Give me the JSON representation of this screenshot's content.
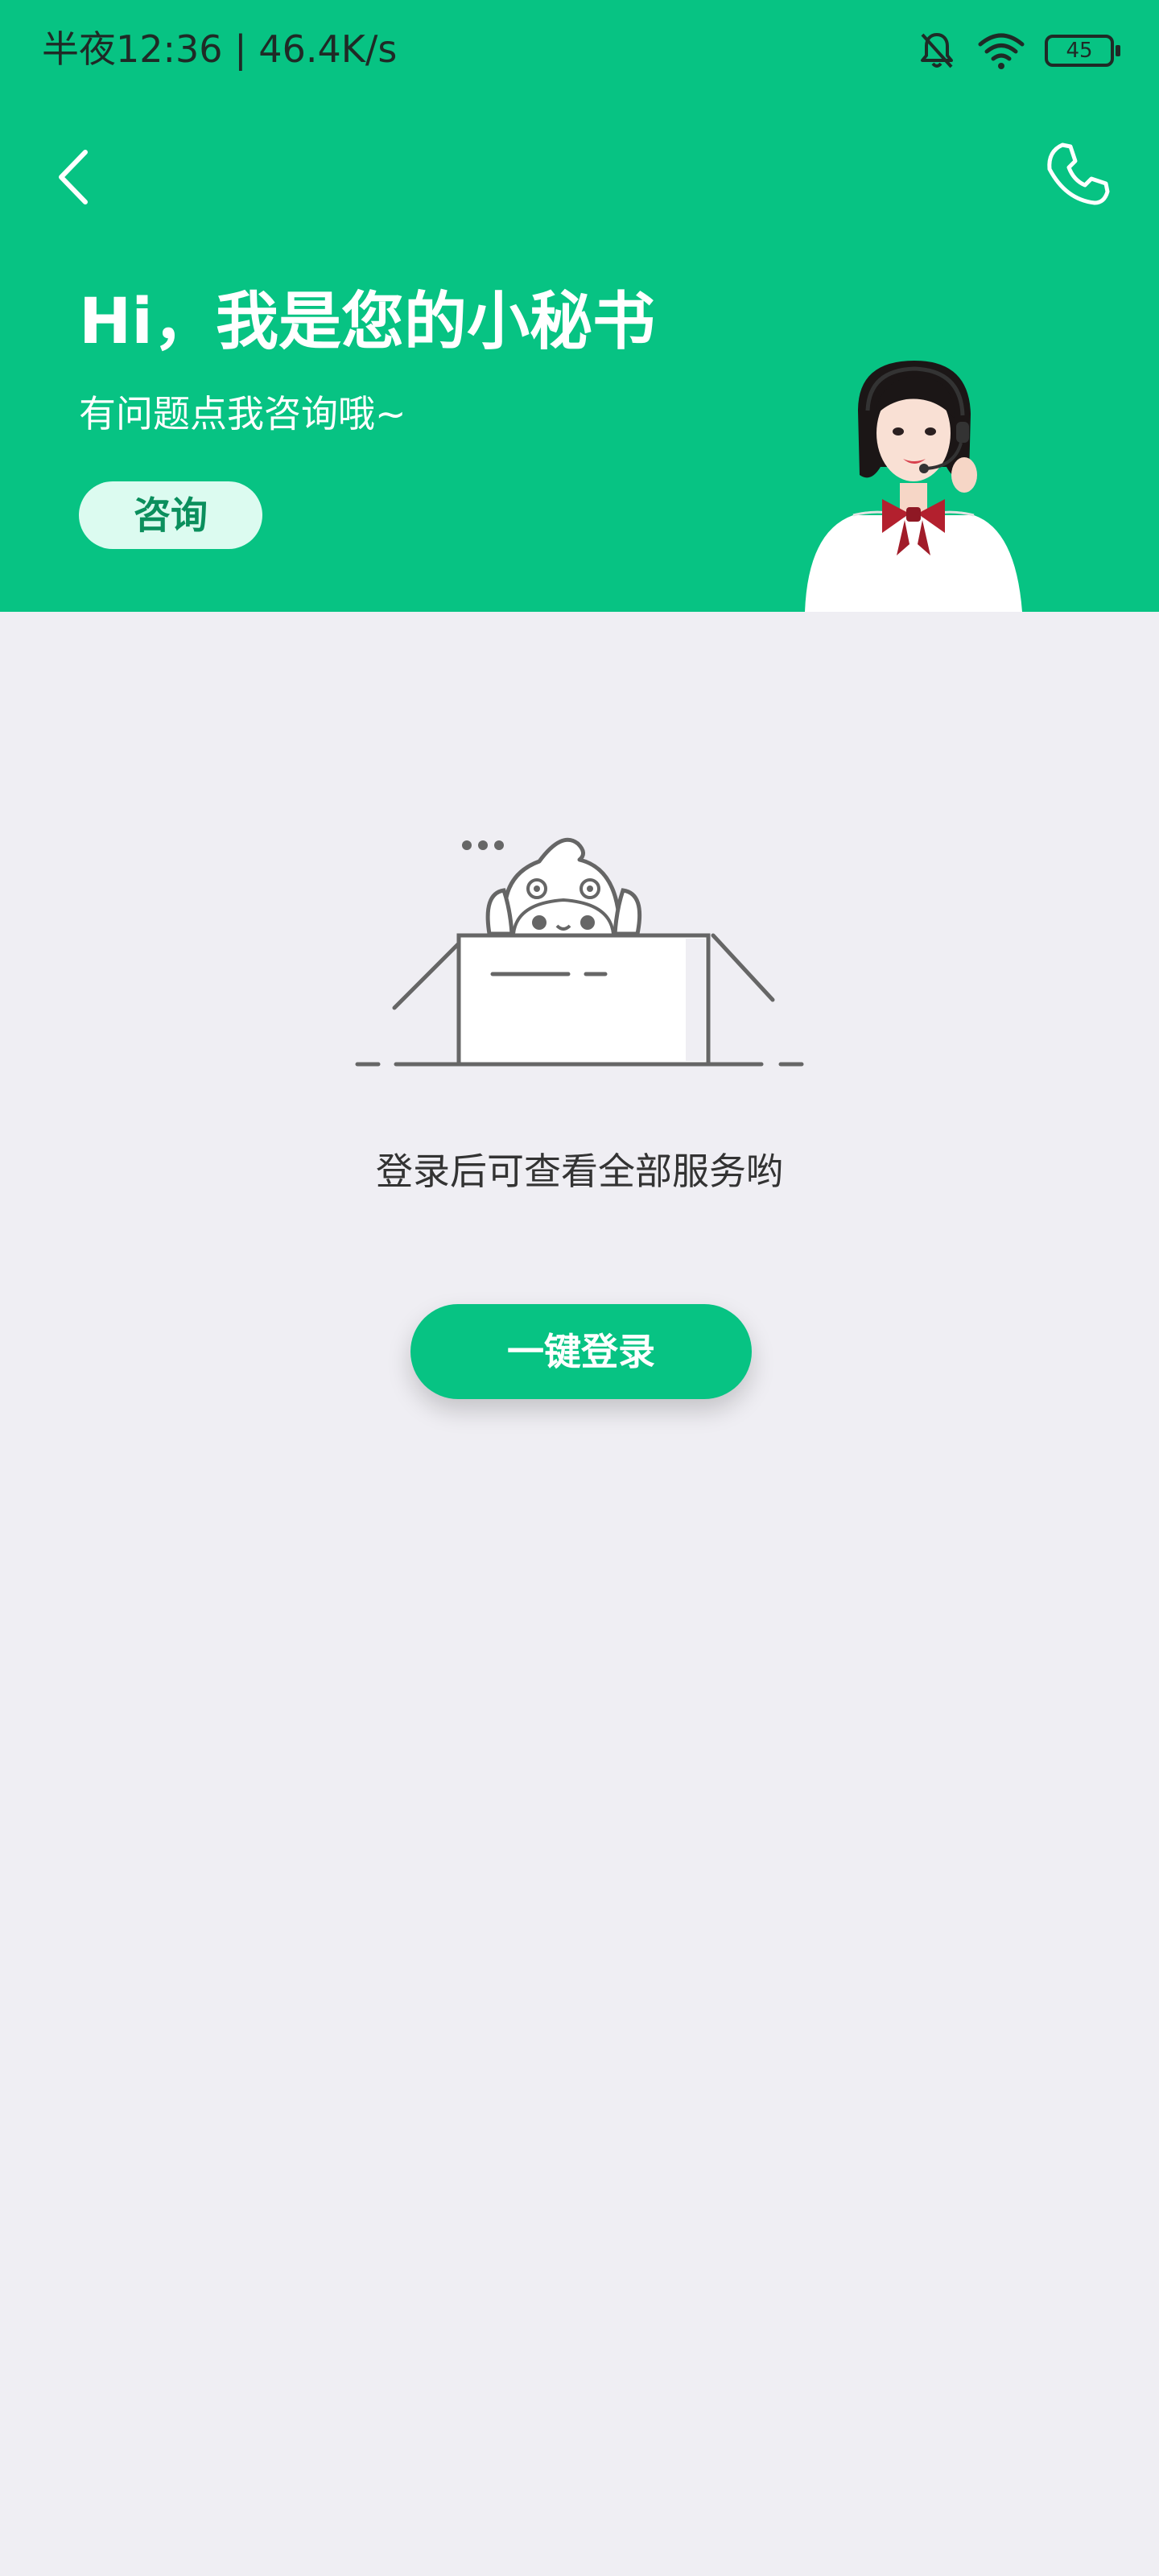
{
  "status_bar": {
    "text": "半夜12:36 | 46.4K/s",
    "battery": "45",
    "icons": [
      "mute-bell-icon",
      "wifi-icon",
      "battery-icon"
    ]
  },
  "nav": {
    "back_icon": "back-chevron-icon",
    "phone_icon": "phone-icon"
  },
  "hero": {
    "title": "Hi，我是您的小秘书",
    "subtitle": "有问题点我咨询哦~",
    "consult_label": "咨询"
  },
  "empty_state": {
    "message": "登录后可查看全部服务哟",
    "login_label": "一键登录"
  },
  "colors": {
    "primary": "#07c383",
    "background": "#efeef3",
    "consult_bg": "#dcfbf0",
    "consult_text": "#0b8f5d"
  }
}
